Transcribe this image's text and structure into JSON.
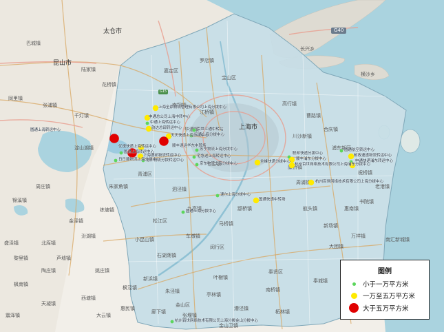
{
  "place_names": {
    "taicang": "太仓市",
    "kunshan": "昆山市",
    "shanghai": "上海市",
    "g40": "G40",
    "g15": "G15",
    "changxing": "长兴乡",
    "hengsha": "横沙乡",
    "baoshan": "宝山区",
    "songjiang": "松江区",
    "jiading": "嘉定区",
    "qingpu": "青浦区",
    "fengxian": "奉贤区",
    "pudong": "浦东新区",
    "minhang": "闵行区",
    "jinshan": "金山区",
    "dianshanhu": "淀山湖镇",
    "zhouzhuang": "周庄镇",
    "jinxi": "锦溪镇",
    "huaqiao": "花桥镇",
    "chuansha": "川沙新镇",
    "zhujiajiao": "朱家角镇",
    "sijing": "泗泾镇",
    "nanqiao": "南桥镇",
    "zhuqiao": "祝桥镇",
    "huinan": "惠南镇",
    "xinchang": "新场镇",
    "jiuting": "九亭镇",
    "chedun": "车墩镇",
    "xinbang": "新浜镇",
    "zhelin": "柘林镇",
    "fengcheng": "奉城镇",
    "shuyuan": "书院镇",
    "laogang": "老港镇",
    "nanhui": "南汇新城镇",
    "xitang": "西塘镇",
    "tianning": "天凝镇",
    "liantang": "练塘镇",
    "jinze": "金泽镇",
    "luodian": "罗店镇",
    "nanxiang": "南翔镇",
    "jiangqiao": "江桥镇",
    "maqiao": "马桥镇",
    "zhuanqiao": "颛桥镇",
    "huacao": "华漕镇",
    "qibao": "七宝镇",
    "gaohang": "高行镇",
    "caolu": "曹路镇",
    "heqing": "合庆镇",
    "zhoupu": "周浦镇",
    "kangqiao": "康桥镇",
    "hangtou": "航头镇",
    "datuan": "大团镇",
    "wanxiang": "万祥镇",
    "xiaokunshan": "小昆山镇",
    "shihudang": "石湖荡镇",
    "yexie": "叶榭镇",
    "tinglin": "亭林镇",
    "zhujing": "朱泾镇",
    "fengjing": "枫泾镇",
    "langxia": "廊下镇",
    "zhangyan": "张堰镇",
    "caojing": "漕泾镇",
    "jinshanwei": "金山卫镇",
    "dayun": "大云镇",
    "huimin": "惠民镇",
    "taozhuang": "陶庄镇",
    "yaozhuang": "姚庄镇",
    "fengnan": "枫南镇",
    "qiandeng": "千灯镇",
    "zhangpu": "张浦镇",
    "bacheng": "巴城镇",
    "lujia": "陆家镇",
    "shengze": "盛泽镇",
    "tongli": "同里镇",
    "lili": "黎里镇",
    "beishe": "北厍镇",
    "luxu": "芦墟镇",
    "fenhu": "汾湖镇",
    "zhenze": "震泽镇"
  },
  "markers": [
    {
      "size": "medium",
      "label": "上海全鼎物流管理有限公司上海分拨中心"
    },
    {
      "size": "medium",
      "label": "申通总公司上海中转中心"
    },
    {
      "size": "small",
      "label": "中通上海转运中心"
    },
    {
      "size": "medium",
      "label": "韵达总部转运中心"
    },
    {
      "size": "small",
      "label": "百世汇通中转站"
    },
    {
      "size": "small",
      "label": "汇通上海分拨中心"
    },
    {
      "size": "large",
      "label": ""
    },
    {
      "size": "large",
      "label": "圆通上海转运中心"
    },
    {
      "size": "medium",
      "label": "天天快递上海分拨中心"
    },
    {
      "size": "large",
      "label": "顺丰速运华东中转场"
    },
    {
      "size": "medium",
      "label": "优速快递上海转运中心"
    },
    {
      "size": "small",
      "label": "国通上海转运中心"
    },
    {
      "size": "medium",
      "label": "上海德邦物流转运中心"
    },
    {
      "size": "small",
      "label": "德邦物流分拨转运中心"
    },
    {
      "size": "small",
      "label": "日日顺物流上海分拨中心"
    },
    {
      "size": "small",
      "label": "苏宁物流上海分拨中心"
    },
    {
      "size": "small",
      "label": "宅急送上海转运中心"
    },
    {
      "size": "small",
      "label": "京东物流上海分拨中心"
    },
    {
      "size": "medium",
      "label": "全峰快递分拨中心"
    },
    {
      "size": "small",
      "label": "联邦快递分拨中心"
    },
    {
      "size": "medium",
      "label": "顺丰浦东分拨中心"
    },
    {
      "size": "medium",
      "label": "杭州百世网络技术有限公司上海浦东分拨中心"
    },
    {
      "size": "small",
      "label": "圆通航空转运中心"
    },
    {
      "size": "medium",
      "label": "邮政速递物流转运中心"
    },
    {
      "size": "small",
      "label": "申通快递浦东转运中心"
    },
    {
      "size": "medium",
      "label": "韵达快递浦东分拨中心"
    },
    {
      "size": "medium",
      "label": "杭州百世网络技术有限公司上海分拨中心"
    },
    {
      "size": "small",
      "label": "速尔上海分拨中心"
    },
    {
      "size": "medium",
      "label": "国通快递中转场"
    },
    {
      "size": "small",
      "label": "圆通上海分拨中心"
    },
    {
      "size": "small",
      "label": "杭州百世网络技术有限公司上海分拨金山分拨中心"
    }
  ],
  "legend": {
    "title": "图例",
    "items": [
      {
        "label": "小于一万平方米",
        "color": "#5cd65c"
      },
      {
        "label": "一万至五万平方米",
        "color": "#ffea00"
      },
      {
        "label": "大于五万平方米",
        "color": "#e00000"
      }
    ]
  }
}
